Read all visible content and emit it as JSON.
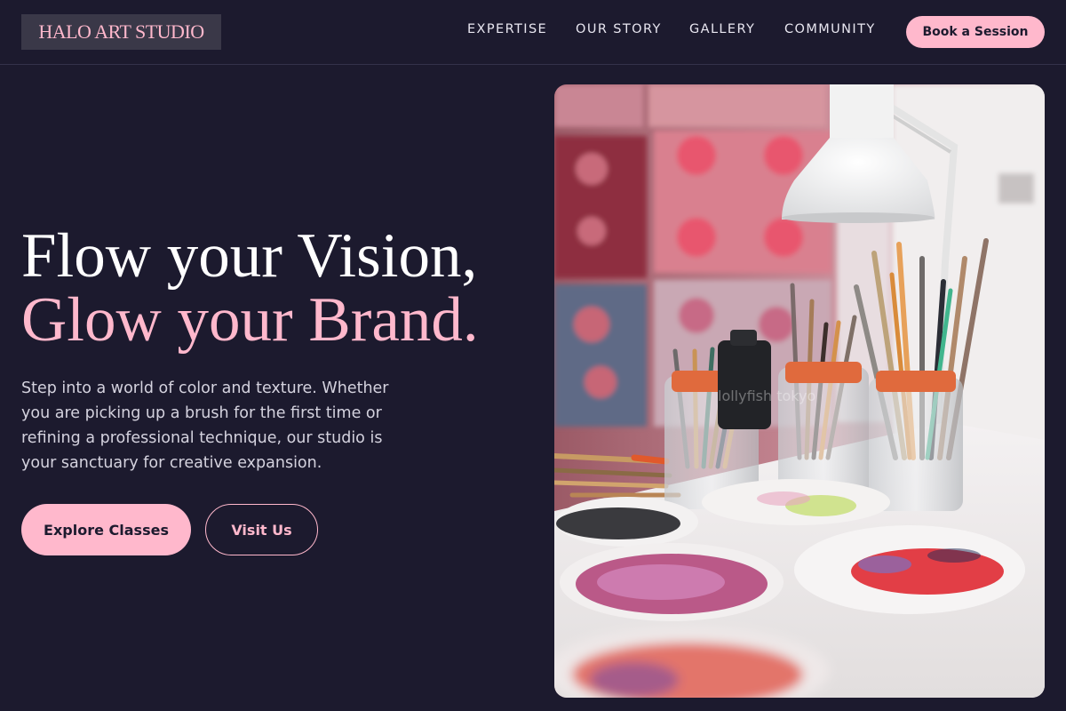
{
  "header": {
    "logo": "HALO ART STUDIO",
    "nav": [
      {
        "label": "EXPERTISE"
      },
      {
        "label": "OUR STORY"
      },
      {
        "label": "GALLERY"
      },
      {
        "label": "COMMUNITY"
      }
    ],
    "cta": "Book a Session"
  },
  "hero": {
    "headline_line1": "Flow your Vision,",
    "headline_line2": "Glow your Brand.",
    "description": "Step into a world of color and texture. Whether you are picking up a brush for the first time or refining a professional technique, our studio is your sanctuary for creative expansion.",
    "primary_button": "Explore Classes",
    "secondary_button": "Visit Us",
    "image_watermark": "lollyfish tokyo"
  },
  "colors": {
    "background": "#1c1a2e",
    "accent": "#ffb8cc",
    "text": "#ffffff",
    "muted_text": "#d4d2de"
  }
}
